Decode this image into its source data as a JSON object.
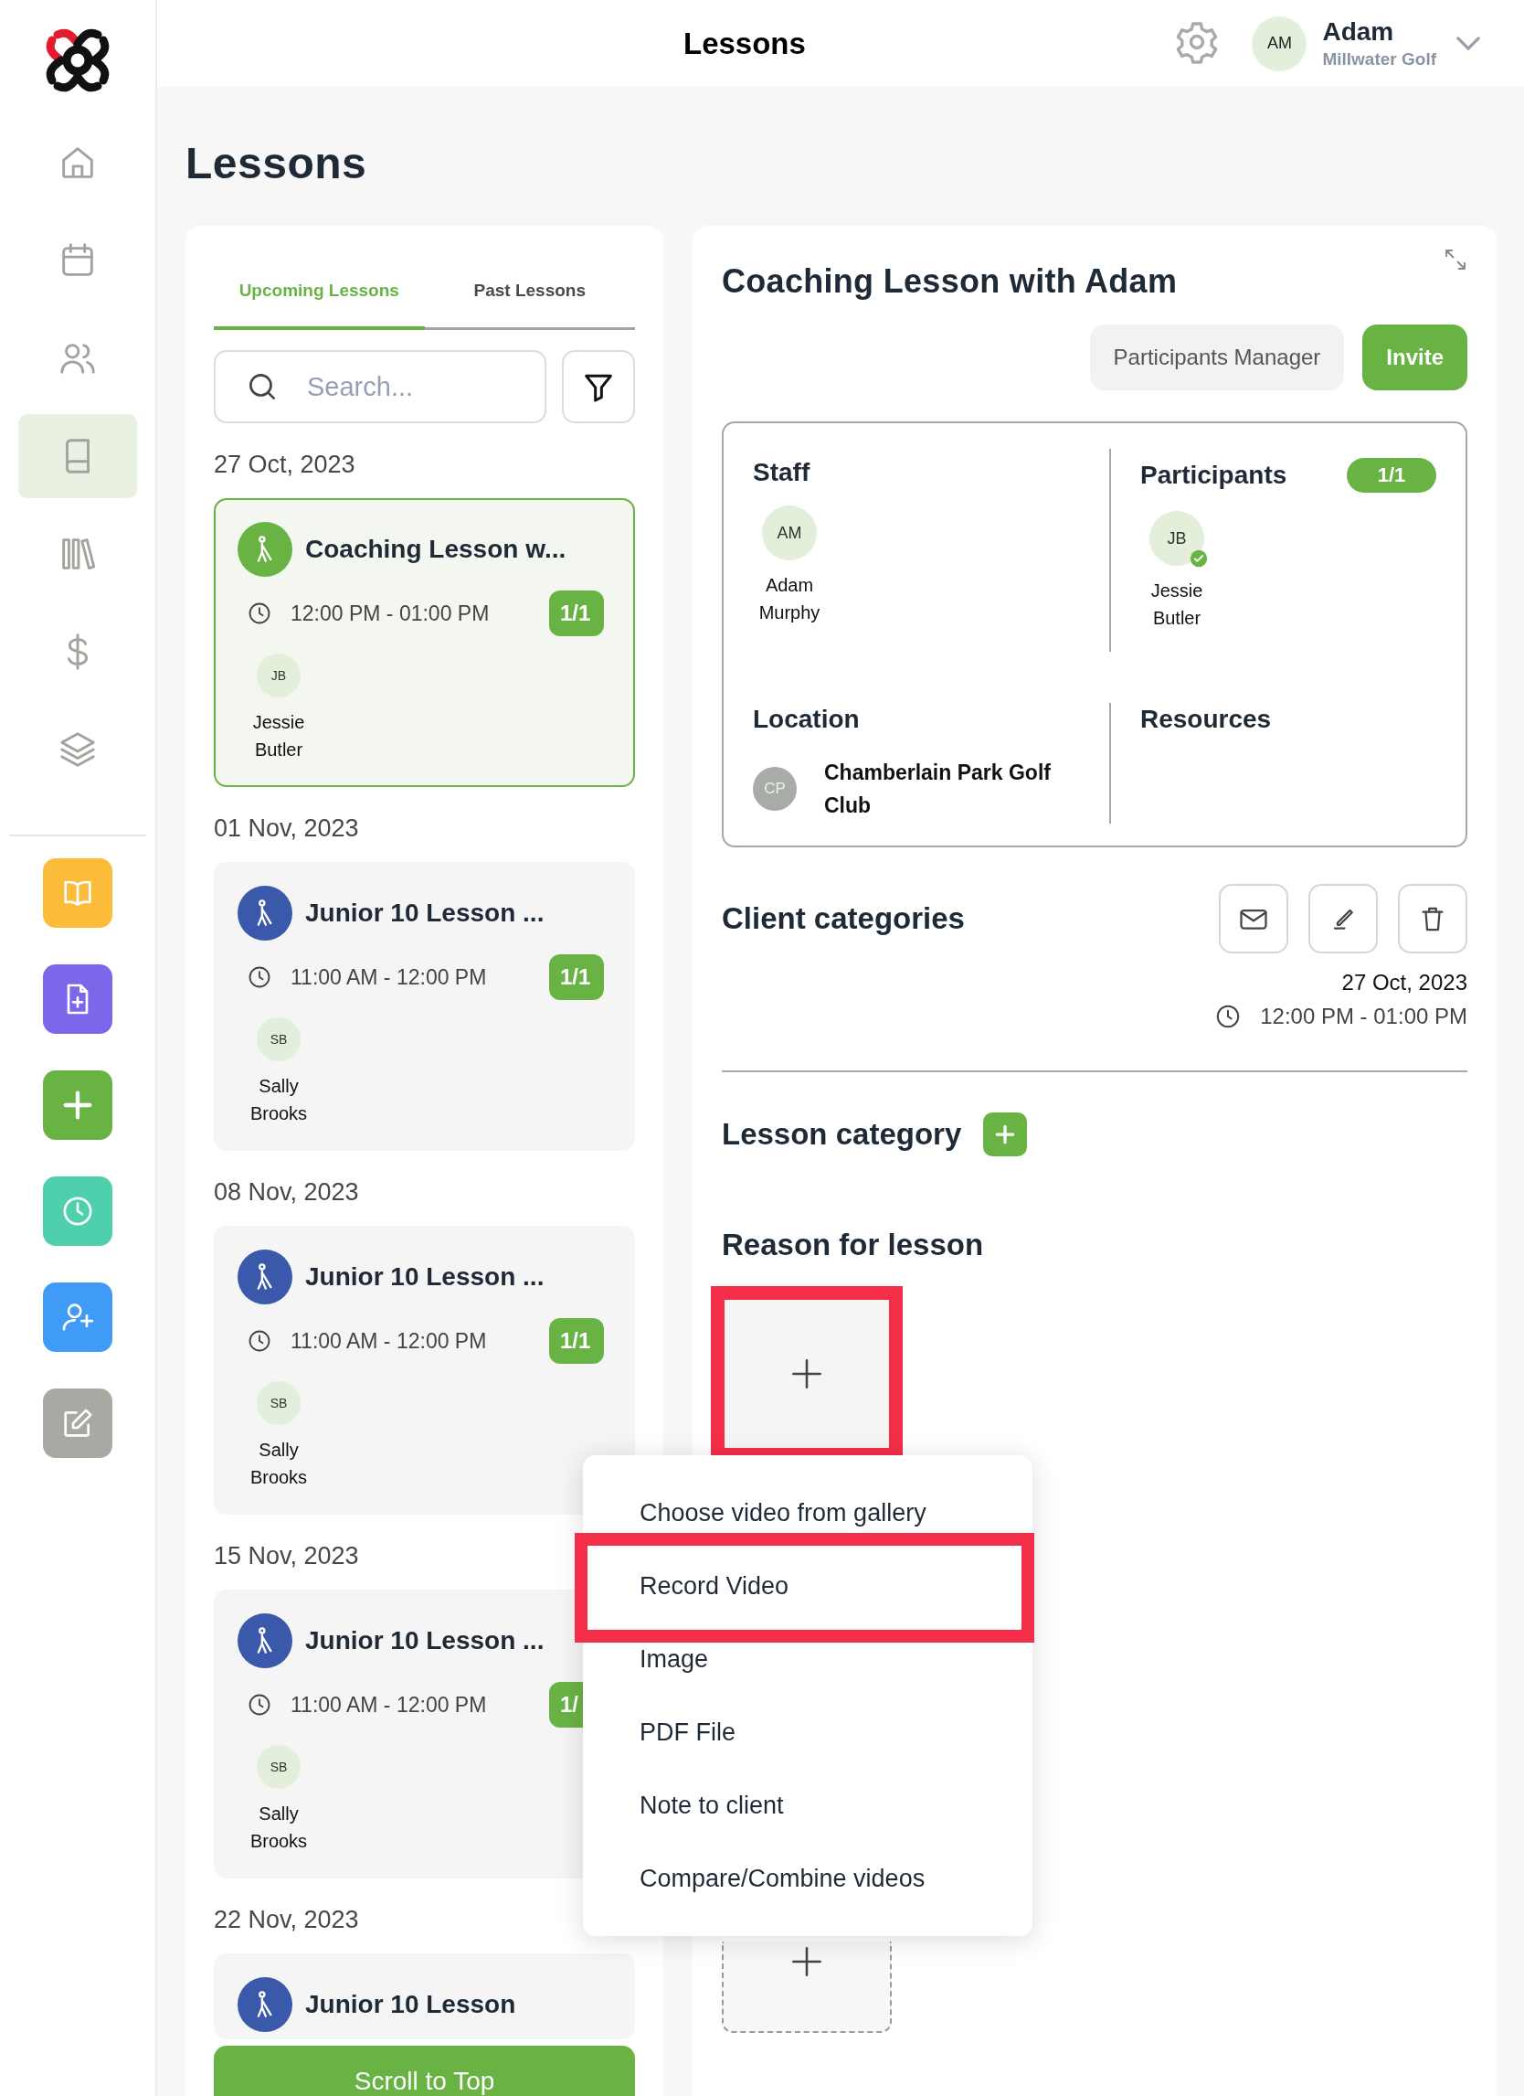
{
  "header": {
    "title": "Lessons",
    "user": {
      "initials": "AM",
      "name": "Adam",
      "org": "Millwater Golf"
    }
  },
  "sidebar": {
    "nav": [
      {
        "kind": "home",
        "selected": false
      },
      {
        "kind": "calendar",
        "selected": false
      },
      {
        "kind": "people",
        "selected": false
      },
      {
        "kind": "book",
        "selected": true
      },
      {
        "kind": "library",
        "selected": false
      },
      {
        "kind": "dollar",
        "selected": false
      },
      {
        "kind": "layers",
        "selected": false
      }
    ],
    "quick_actions": [
      {
        "kind": "open-book",
        "color": "#fbbc3a"
      },
      {
        "kind": "file-plus",
        "color": "#7d66ea"
      },
      {
        "kind": "plus",
        "color": "#69b345"
      },
      {
        "kind": "clock",
        "color": "#4fd0ad"
      },
      {
        "kind": "user-plus",
        "color": "#3f9bf6"
      },
      {
        "kind": "edit",
        "color": "#a6aaa3"
      }
    ]
  },
  "page_title": "Lessons",
  "tabs": [
    {
      "label": "Upcoming Lessons",
      "selected": true
    },
    {
      "label": "Past Lessons",
      "selected": false
    }
  ],
  "search": {
    "placeholder": "Search..."
  },
  "lesson_groups": [
    {
      "date": "27 Oct, 2023",
      "lessons": [
        {
          "kind": "coaching",
          "selected": true,
          "title": "Coaching Lesson w...",
          "time": "12:00 PM - 01:00 PM",
          "count": "1/1",
          "participants": [
            {
              "initials": "JB",
              "name": "Jessie Butler"
            }
          ]
        }
      ]
    },
    {
      "date": "01 Nov, 2023",
      "lessons": [
        {
          "kind": "junior",
          "selected": false,
          "title": "Junior 10 Lesson ...",
          "time": "11:00 AM - 12:00 PM",
          "count": "1/1",
          "participants": [
            {
              "initials": "SB",
              "name": "Sally Brooks"
            }
          ]
        }
      ]
    },
    {
      "date": "08 Nov, 2023",
      "lessons": [
        {
          "kind": "junior",
          "selected": false,
          "title": "Junior 10 Lesson ...",
          "time": "11:00 AM - 12:00 PM",
          "count": "1/1",
          "participants": [
            {
              "initials": "SB",
              "name": "Sally Brooks"
            }
          ]
        }
      ]
    },
    {
      "date": "15 Nov, 2023",
      "lessons": [
        {
          "kind": "junior",
          "selected": false,
          "title": "Junior 10 Lesson ...",
          "time": "11:00 AM - 12:00 PM",
          "count": "1/",
          "participants": [
            {
              "initials": "SB",
              "name": "Sally Brooks"
            }
          ]
        }
      ]
    },
    {
      "date": "22 Nov, 2023",
      "lessons": [
        {
          "kind": "junior",
          "selected": false,
          "title": "Junior 10 Lesson"
        }
      ]
    }
  ],
  "scroll_button": "Scroll to Top",
  "detail": {
    "title": "Coaching Lesson with Adam",
    "buttons": [
      {
        "kind": "secondary",
        "label": "Participants Manager"
      },
      {
        "kind": "primary",
        "label": "Invite"
      }
    ],
    "staff": {
      "label": "Staff",
      "people": [
        {
          "initials": "AM",
          "name": "Adam Murphy",
          "confirmed": false
        }
      ]
    },
    "participants": {
      "label": "Participants",
      "count": "1/1",
      "people": [
        {
          "initials": "JB",
          "name": "Jessie Butler",
          "confirmed": true
        }
      ]
    },
    "location": {
      "label": "Location",
      "initials": "CP",
      "name": "Chamberlain Park Golf Club"
    },
    "resources": {
      "label": "Resources"
    },
    "client_categories": {
      "label": "Client categories",
      "date": "27 Oct, 2023",
      "time": "12:00 PM - 01:00 PM"
    },
    "lesson_category": {
      "label": "Lesson category"
    },
    "reason": {
      "label": "Reason for lesson",
      "tiles": [
        {
          "kind": "filled",
          "highlighted": true
        },
        {
          "kind": "dashed",
          "highlighted": false
        }
      ]
    }
  },
  "menu": {
    "items": [
      {
        "label": "Choose video from gallery",
        "highlighted": false
      },
      {
        "label": "Record Video",
        "highlighted": true
      },
      {
        "label": "Image",
        "highlighted": false
      },
      {
        "label": "PDF File",
        "highlighted": false
      },
      {
        "label": "Note to client",
        "highlighted": false
      },
      {
        "label": "Compare/Combine videos",
        "highlighted": false
      }
    ]
  }
}
